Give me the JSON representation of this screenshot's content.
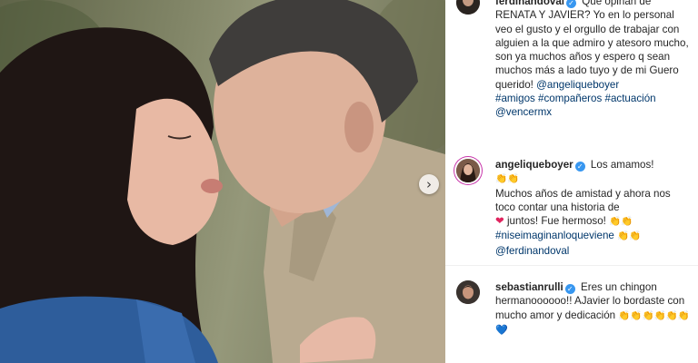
{
  "post": {
    "caption": {
      "username": "ferdinandoval",
      "text": "Que opinan de RENATA Y JAVIER? Yo en lo personal veo el gusto y el orgullo de trabajar con alguien a la que admiro y atesoro mucho, son ya muchos años y espero q sean muchos más a lado tuyo y de mi Guero querido!",
      "mention": "@angeliqueboyer",
      "hashtags": "#amigos #compañeros #actuación",
      "mention2": "@vencermx"
    },
    "comments": [
      {
        "username": "angeliqueboyer",
        "line1": "Los amamos!",
        "emoji1": "👏👏",
        "text2": "Muchos años de amistad y ahora nos toco contar una historia de",
        "heart": "❤",
        "text3": "juntos! Fue hermoso!",
        "emoji2": "👏👏",
        "hashtag": "#niseimaginanloqueviene",
        "emoji3": "👏👏",
        "mention": "@ferdinandoval"
      },
      {
        "username": "sebastianrulli",
        "text": "Eres un chingon hermanoooooo!! AJavier lo bordaste con mucho amor y dedicación",
        "emoji": "👏👏👏👏👏👏",
        "heart": "💙"
      }
    ]
  },
  "icons": {
    "verified": "verified-badge-icon",
    "carousel_next": "chevron-right-icon"
  },
  "colors": {
    "verified": "#3897f0",
    "link": "#00376b",
    "heart": "#e0245e"
  }
}
